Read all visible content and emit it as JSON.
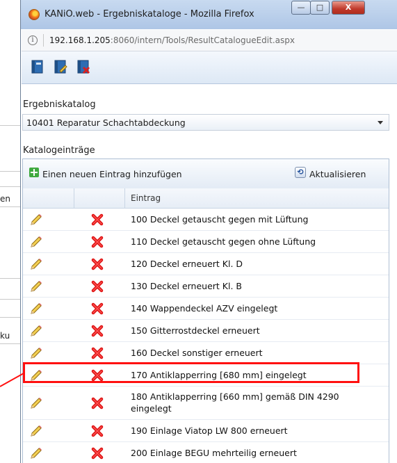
{
  "background_page": {
    "fragments": [
      "en",
      "ku"
    ]
  },
  "window": {
    "title": "KANiO.web - Ergebniskataloge - Mozilla Firefox",
    "minimize_glyph": "—",
    "maximize_glyph": "□",
    "close_glyph": "X"
  },
  "urlbar": {
    "info_glyph": "i",
    "host": "192.168.1.205",
    "path": ":8060/intern/Tools/ResultCatalogueEdit.aspx"
  },
  "toolbar": {
    "icons": [
      "save-icon",
      "save-edit-icon",
      "delete-icon"
    ]
  },
  "form": {
    "catalog_label": "Ergebniskatalog",
    "catalog_value": "10401 Reparatur Schachtabdeckung",
    "entries_label": "Katalogeinträge"
  },
  "grid": {
    "add_label": "Einen neuen Eintrag hinzufügen",
    "refresh_label": "Aktualisieren",
    "column_header": "Eintrag",
    "rows": [
      "100 Deckel getauscht gegen mit Lüftung",
      "110 Deckel getauscht gegen ohne Lüftung",
      "120 Deckel erneuert Kl. D",
      "130 Deckel erneuert Kl. B",
      "140 Wappendeckel AZV eingelegt",
      "150 Gitterrostdeckel erneuert",
      "160 Deckel sonstiger erneuert",
      "170 Antiklapperring [680 mm] eingelegt",
      "180 Antiklapperring [660 mm] gemäß DIN 4290 eingelegt",
      "190 Einlage Viatop LW 800 erneuert",
      "200 Einlage BEGU mehrteilig erneuert"
    ],
    "highlighted_row": "170 Antiklapperring [680 mm] eingelegt"
  },
  "colors": {
    "highlight": "#ff1010",
    "titlebar": "#b9cfec"
  }
}
